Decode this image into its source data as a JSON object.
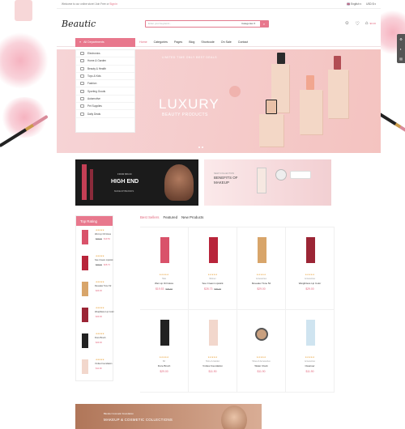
{
  "topbar": {
    "notice": "Welcome to our online store! Join Free or ",
    "signin": "Sign in",
    "language": "English",
    "currency": "USD $"
  },
  "header": {
    "logo": "Beautic",
    "search_placeholder": "Enter your keyword...",
    "search_category": "Categories",
    "cart_amount": "$0.00",
    "wishlist_count": "0",
    "cart_count": "0"
  },
  "nav": {
    "all_departments": "All Departments",
    "items": [
      "Home",
      "Categories",
      "Pages",
      "Blog",
      "Shortcode",
      "On Sale",
      "Contact"
    ]
  },
  "departments": [
    "Electronics",
    "Home & Garden",
    "Beauty & Health",
    "Toys & Kids",
    "Fashion",
    "Sporting Goods",
    "Automotive",
    "Pet Supplies",
    "Daily Deals"
  ],
  "hero": {
    "subtitle": "LIMITED TIME ONLY BEST DEALS",
    "title": "LUXURY",
    "title2": "BEAUTY PRODUCTS"
  },
  "banner1": {
    "small": "FROM $59.00",
    "title": "HIGH END",
    "sub": "MAKEUP BRANDS",
    "button": "SHOP NOW"
  },
  "banner2": {
    "small": "NEW COLLECTION",
    "title": "BENEFITS OF MAKEUP",
    "button": "SHOP NOW"
  },
  "top_rating": {
    "title": "Top Rating",
    "items": [
      {
        "name": "Wet Lip Oil Gloss",
        "old": "$20.10",
        "price": "$19.53"
      },
      {
        "name": "Soe Cream Lipstick",
        "old": "$30.10",
        "price": "$28.73"
      },
      {
        "name": "Revealer Tone 52",
        "old": "",
        "price": "$29.00"
      },
      {
        "name": "Weightless Lip Color",
        "old": "",
        "price": "$29.00"
      },
      {
        "name": "Fiore Brush",
        "old": "",
        "price": "$29.00"
      },
      {
        "name": "Vmiles Foundation",
        "old": "",
        "price": "$11.90"
      }
    ]
  },
  "tabs": [
    "Best Sellers",
    "Featured",
    "New Products"
  ],
  "products": [
    {
      "cat": "Hats",
      "name": "Wet Lip Oil Gloss",
      "price": "$19.53",
      "old": "$20.10"
    },
    {
      "cat": "Women",
      "name": "Soe Cream Lipstick",
      "price": "$28.73",
      "old": "$30.10"
    },
    {
      "cat": "Accessories",
      "name": "Revealer Tone 52",
      "price": "$29.00",
      "old": ""
    },
    {
      "cat": "Accessories",
      "name": "Weightless Lip Color",
      "price": "$29.00",
      "old": ""
    },
    {
      "cat": "Bd",
      "name": "Fiore Brush",
      "price": "$29.00",
      "old": ""
    },
    {
      "cat": "Home & Garden",
      "name": "Vmiles Foundation",
      "price": "$11.90",
      "old": ""
    },
    {
      "cat": "Shoes & Accessories",
      "name": "Water Clock",
      "price": "$11.90",
      "old": ""
    },
    {
      "cat": "Accessories",
      "name": "Cleanser",
      "price": "$11.90",
      "old": ""
    }
  ],
  "bottom_banner": {
    "small": "Blender Cosmetic Foundation",
    "title": "MAKEUP & COSMETIC COLLECTIONS"
  },
  "stars": "★★★★★",
  "colors": {
    "accent": "#e8788d"
  }
}
